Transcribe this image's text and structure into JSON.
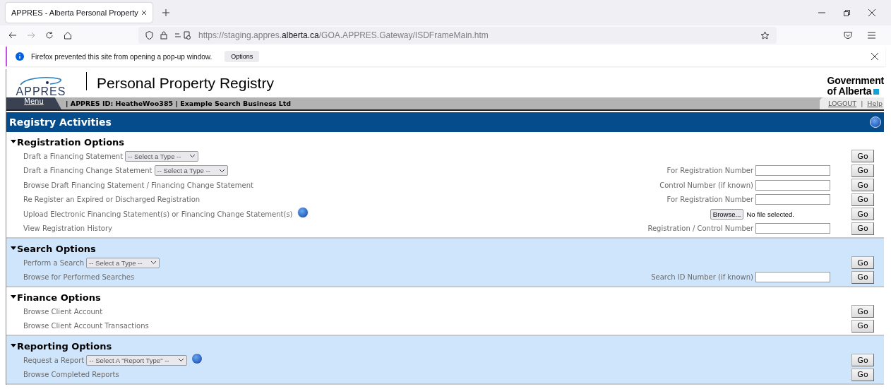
{
  "browser": {
    "tab_title": "APPRES - Alberta Personal Property",
    "url_prefix": "https://staging.appres.",
    "url_domain": "alberta.ca",
    "url_path": "/GOA.APPRES.Gateway/ISDFrameMain.htm",
    "notice": "Firefox prevented this site from opening a pop-up window.",
    "notice_button": "Options"
  },
  "header": {
    "logo": "APPRES",
    "title": "Personal Property Registry",
    "government": [
      "Government",
      "of Alberta"
    ]
  },
  "menu_bar": {
    "menu": "Menu",
    "separator": "|",
    "user": "APPRES ID: HeatheWoo385",
    "separator2": "|",
    "business": "Example Search Business Ltd",
    "links": [
      "LOGOUT",
      "Help"
    ],
    "link_separator": "|"
  },
  "activities": {
    "title": "Registry Activities"
  },
  "sections": [
    {
      "title": "Registration Options",
      "shaded": false,
      "rows": [
        {
          "label": "Draft a Financing Statement",
          "select": "-- Select a Type --",
          "help": false,
          "go": "Go"
        },
        {
          "label": "Draft a Financing Change Statement",
          "select": "-- Select a Type --",
          "help": false,
          "field_label": "For Registration Number",
          "go": "Go"
        },
        {
          "label": "Browse Draft Financing Statement / Financing Change Statement",
          "help": false,
          "field_label": "Control Number (if known)",
          "go": "Go"
        },
        {
          "label": "Re Register an Expired or Discharged Registration",
          "help": false,
          "field_label": "For Registration Number",
          "go": "Go"
        },
        {
          "label": "Upload Electronic Financing Statement(s) or Financing Change Statement(s)",
          "help": true,
          "file_button": "Browse...",
          "file_status": "No file selected.",
          "go": "Go"
        },
        {
          "label": "View Registration History",
          "help": false,
          "field_label": "Registration / Control Number",
          "go": "Go"
        }
      ]
    },
    {
      "title": "Search Options",
      "shaded": true,
      "rows": [
        {
          "label": "Perform a Search",
          "select": "-- Select a Type --",
          "help": false,
          "go": "Go"
        },
        {
          "label": "Browse for Performed Searches",
          "help": false,
          "field_label": "Search ID Number (if known)",
          "go": "Go"
        }
      ]
    },
    {
      "title": "Finance Options",
      "shaded": false,
      "rows": [
        {
          "label": "Browse Client Account",
          "help": false,
          "go": "Go"
        },
        {
          "label": "Browse Client Account Transactions",
          "help": false,
          "go": "Go"
        }
      ]
    },
    {
      "title": "Reporting Options",
      "shaded": true,
      "rows": [
        {
          "label": "Request a Report",
          "select": "-- Select A \"Report Type\" --",
          "help": true,
          "go": "Go"
        },
        {
          "label": "Browse Completed Reports",
          "help": false,
          "go": "Go"
        }
      ]
    }
  ]
}
